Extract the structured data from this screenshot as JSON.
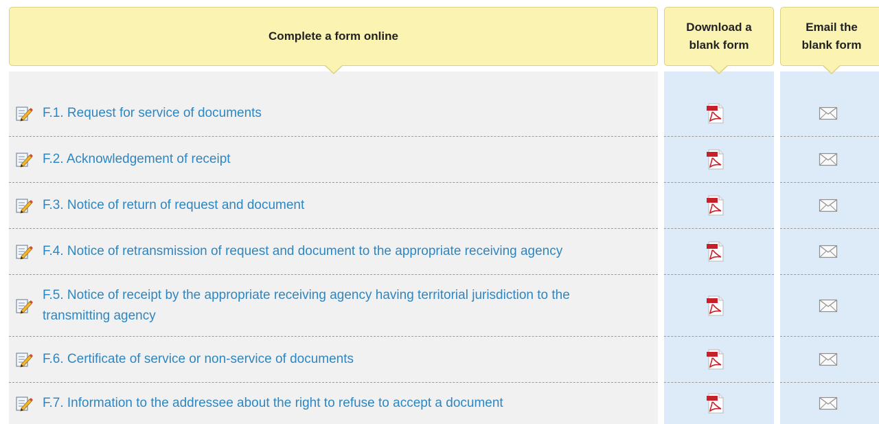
{
  "headers": {
    "online": "Complete a form online",
    "download_line1": "Download a",
    "download_line2": "blank form",
    "email_line1": "Email the",
    "email_line2": "blank form"
  },
  "forms": [
    {
      "label": "F.1. Request for service of documents"
    },
    {
      "label": "F.2. Acknowledgement of receipt"
    },
    {
      "label": "F.3. Notice of return of request and document"
    },
    {
      "label": "F.4. Notice of retransmission of request and document to the appropriate receiving agency"
    },
    {
      "label": "F.5. Notice of receipt by the appropriate receiving agency having territorial jurisdiction to the transmitting agency"
    },
    {
      "label": "F.6. Certificate of service or non-service of documents"
    },
    {
      "label": "F.7. Information to the addressee about the right to refuse to accept a document"
    }
  ],
  "icons": {
    "edit": "edit-form-icon",
    "pdf": "pdf-icon",
    "mail": "mail-icon"
  },
  "colors": {
    "header_bg": "#fbf3b2",
    "link": "#2e86c1",
    "column_bg": "#dcebf7",
    "pdf_red": "#c8202a"
  }
}
